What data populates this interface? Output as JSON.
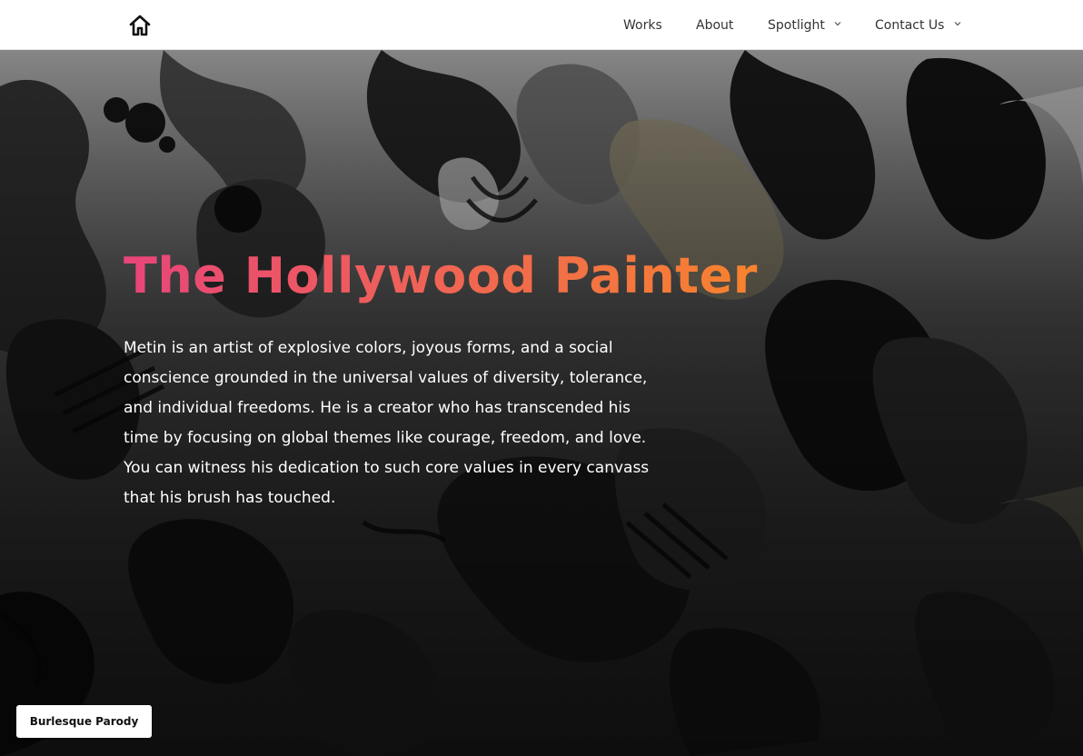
{
  "nav": {
    "home_icon": "home-icon",
    "items": [
      {
        "label": "Works",
        "has_dropdown": false
      },
      {
        "label": "About",
        "has_dropdown": false
      },
      {
        "label": "Spotlight",
        "has_dropdown": true
      },
      {
        "label": "Contact Us",
        "has_dropdown": true
      }
    ]
  },
  "hero": {
    "title": "The Hollywood Painter",
    "title_gradient": [
      "#e8457a",
      "#f7832e"
    ],
    "description": "Metin is an artist of explosive colors, joyous forms, and a social conscience grounded in the universal values of diversity, tolerance, and individual freedoms. He is a creator who has transcended his time by focusing on global themes like courage, freedom, and love. You can witness his dedication to such core values in every canvass that his brush has touched."
  },
  "artwork_tag": {
    "label": "Burlesque Parody"
  },
  "colors": {
    "nav_background": "#ffffff",
    "nav_text": "#333333",
    "hero_text": "#ffffff"
  }
}
